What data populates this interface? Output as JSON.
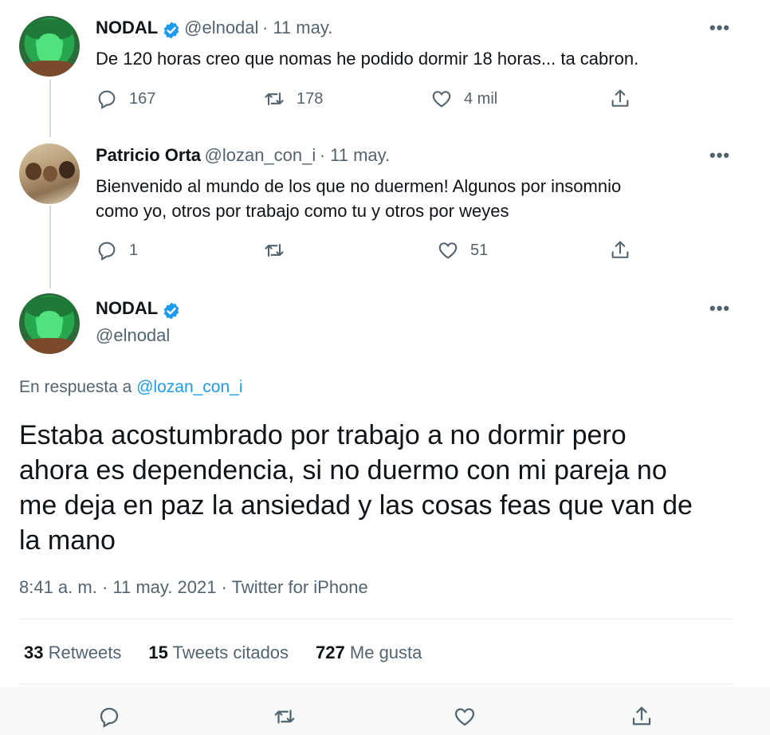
{
  "tweets": [
    {
      "name": "NODAL",
      "handle": "@elnodal",
      "date": "· 11 may.",
      "text": "De 120 horas creo que nomas he podido dormir 18 horas... ta cabron.",
      "replies": "167",
      "retweets": "178",
      "likes": "4 mil"
    },
    {
      "name": "Patricio Orta",
      "handle": "@lozan_con_i",
      "date": "· 11 may.",
      "text_line1": "Bienvenido al mundo de los que no duermen! Algunos por insomnio",
      "text_line2": "como yo, otros por trabajo como tu y otros por weyes",
      "replies": "1",
      "retweets": "",
      "likes": "51"
    }
  ],
  "main": {
    "name": "NODAL",
    "handle": "@elnodal",
    "reply_prefix": "En respuesta a",
    "reply_handle": "@lozan_con_i",
    "text_lines": [
      "Estaba acostumbrado por trabajo a no dormir pero",
      "ahora es dependencia, si no duermo con mi pareja no",
      "me deja en paz la ansiedad y las cosas feas que van de",
      "la mano"
    ],
    "timestamp": "8:41 a. m. · 11 may. 2021 · Twitter for iPhone",
    "stats": {
      "retweets_count": "33",
      "retweets_label": "Retweets",
      "quotes_count": "15",
      "quotes_label": "Tweets citados",
      "likes_count": "727",
      "likes_label": "Me gusta"
    }
  },
  "more_label": "•••",
  "colors": {
    "accent": "#1d9bf0",
    "muted": "#536471",
    "text": "#0f1419"
  },
  "icons": [
    "verified-badge-icon",
    "reply-icon",
    "retweet-icon",
    "like-icon",
    "share-icon",
    "more-icon"
  ]
}
